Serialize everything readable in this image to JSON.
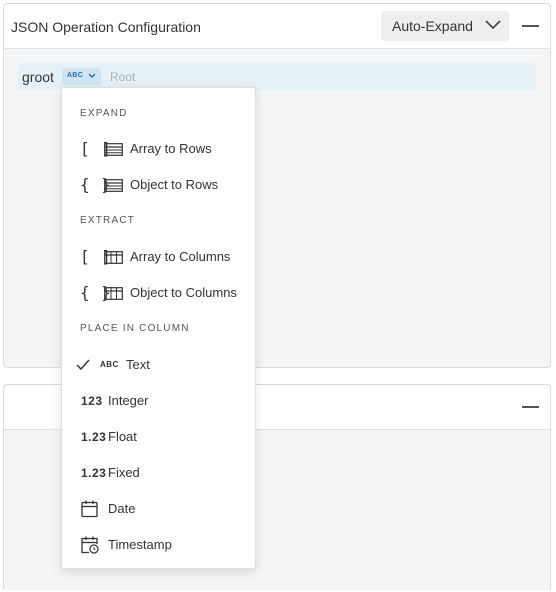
{
  "panel1": {
    "title": "JSON Operation Configuration",
    "auto_expand_label": "Auto-Expand",
    "root": {
      "name": "groot",
      "type_badge": "ABC",
      "placeholder": "Root"
    }
  },
  "menu": {
    "expand_header": "EXPAND",
    "expand_items": [
      {
        "bracket": "[ ]",
        "label": "Array to Rows"
      },
      {
        "bracket": "{ }",
        "label": "Object to Rows"
      }
    ],
    "extract_header": "EXTRACT",
    "extract_items": [
      {
        "bracket": "[ ]",
        "label": "Array to Columns"
      },
      {
        "bracket": "{ }",
        "label": "Object to Columns"
      }
    ],
    "place_header": "PLACE IN COLUMN",
    "text_item": {
      "badge": "ABC",
      "label": "Text",
      "selected": true
    },
    "integer_item": {
      "badge": "123",
      "label": "Integer"
    },
    "float_item": {
      "badge": "1.23",
      "label": "Float"
    },
    "fixed_item": {
      "badge": "1.23",
      "label": "Fixed"
    },
    "date_item": {
      "label": "Date"
    },
    "timestamp_item": {
      "label": "Timestamp"
    }
  },
  "icons": {
    "chevron": "chevron-down-icon",
    "rows": "rows-table-icon",
    "columns": "columns-table-icon",
    "check": "check-icon",
    "calendar": "calendar-icon",
    "calendar_clock": "calendar-clock-icon"
  },
  "colors": {
    "root_row_bg": "#e6f0f7",
    "type_chip_bg": "#cfe3f1",
    "type_chip_text": "#2a6da4",
    "panel_bg": "#f4f5f6"
  }
}
